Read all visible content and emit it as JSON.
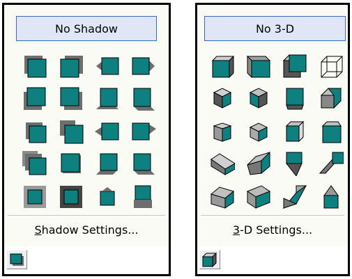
{
  "colors": {
    "teal": "#0f8080",
    "teal_dark": "#0b5c5c",
    "grey": "#7a7a7a"
  },
  "shadow_panel": {
    "top_button": "No Shadow",
    "settings_label_prefix": "S",
    "settings_label_rest": "hadow Settings...",
    "status_icon": "shadow-style-icon"
  },
  "threed_panel": {
    "top_button": "No 3-D",
    "settings_label_prefix": "3",
    "settings_label_rest": "-D Settings...",
    "status_icon": "3d-style-icon"
  }
}
